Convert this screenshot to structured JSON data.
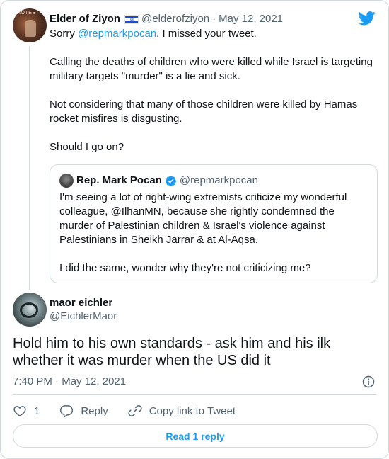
{
  "parent": {
    "avatar_text": "ROTEST",
    "name": "Elder of Ziyon",
    "handle": "@elderofziyon",
    "separator": "·",
    "date": "May 12, 2021",
    "reply_prefix": "Sorry ",
    "reply_mention": "@repmarkpocan",
    "reply_suffix": ", I missed your tweet.",
    "para1": "Calling the deaths of children who were killed while Israel is targeting military targets \"murder\" is a lie and sick.",
    "para2": "Not considering that many of those children were killed by Hamas rocket misfires is disgusting.",
    "para3": "Should I go on?"
  },
  "quote": {
    "name": "Rep. Mark Pocan",
    "handle": "@repmarkpocan",
    "para1_a": "I'm seeing a lot of right-wing extremists criticize my wonderful colleague, @IlhanMN, because she rightly condemned the murder of Palestinian children & Israel's violence against Palestinians in Sheikh Jarrar & at Al-Aqsa.",
    "para2": "I did the same, wonder why they're not criticizing me?"
  },
  "reply": {
    "name": "maor eichler",
    "handle": "@EichlerMaor",
    "text": "Hold him to his own standards - ask him and his ilk whether it was murder when the US did it",
    "time": "7:40 PM",
    "separator": "·",
    "date": "May 12, 2021"
  },
  "actions": {
    "like_count": "1",
    "reply_label": "Reply",
    "copy_label": "Copy link to Tweet"
  },
  "read_button": "Read 1 reply",
  "colors": {
    "accent": "#1d9bf0",
    "muted": "#536471",
    "border": "#cfd9de",
    "text": "#0f1419"
  },
  "icons": {
    "brand": "twitter-bird-icon",
    "flag": "israel-flag-icon",
    "verified": "verified-badge-icon",
    "info": "info-icon",
    "like": "heart-icon",
    "reply": "reply-bubble-icon",
    "copy": "link-icon"
  }
}
